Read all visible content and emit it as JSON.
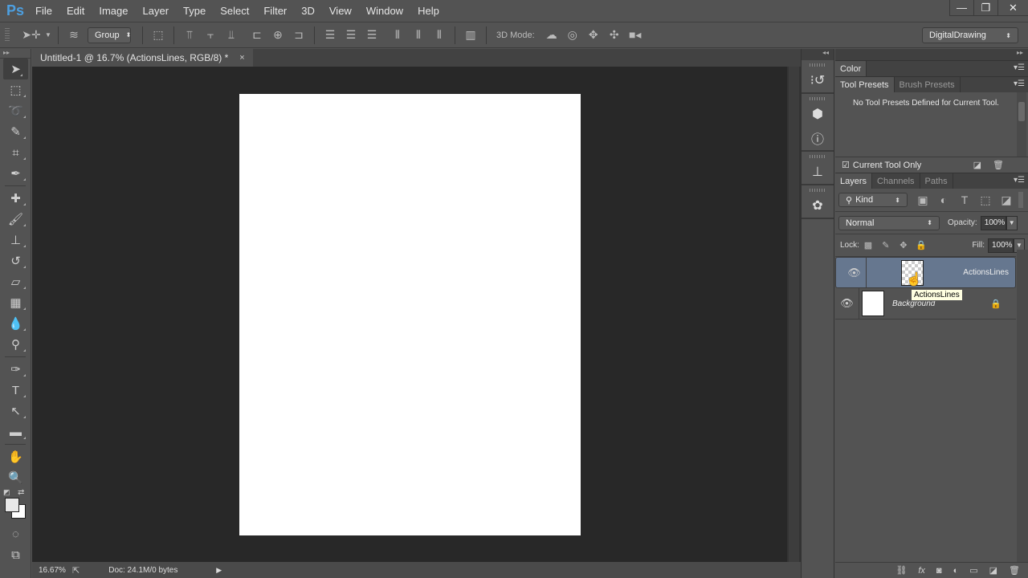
{
  "app": {
    "logo": "Ps",
    "name": "Photoshop"
  },
  "menu": [
    "File",
    "Edit",
    "Image",
    "Layer",
    "Type",
    "Select",
    "Filter",
    "3D",
    "View",
    "Window",
    "Help"
  ],
  "window_controls": {
    "minimize": "—",
    "restore": "❐",
    "close": "✕"
  },
  "options_bar": {
    "auto_select_value": "Group",
    "mode_3d_label": "3D Mode:",
    "workspace": "DigitalDrawing"
  },
  "document": {
    "tab_title": "Untitled-1 @ 16.7% (ActionsLines, RGB/8) *",
    "close_glyph": "×",
    "canvas_color": "#ffffff"
  },
  "status_bar": {
    "zoom": "16.67%",
    "doc_info": "Doc: 24.1M/0 bytes"
  },
  "tools": [
    {
      "name": "move-tool",
      "glyph": "➤"
    },
    {
      "name": "marquee-tool",
      "glyph": "⬚"
    },
    {
      "name": "lasso-tool",
      "glyph": "➰"
    },
    {
      "name": "quick-selection-tool",
      "glyph": "✎"
    },
    {
      "name": "crop-tool",
      "glyph": "⌗"
    },
    {
      "name": "eyedropper-tool",
      "glyph": "✒"
    },
    {
      "name": "healing-brush-tool",
      "glyph": "✚"
    },
    {
      "name": "brush-tool",
      "glyph": "🖌"
    },
    {
      "name": "clone-stamp-tool",
      "glyph": "⊥"
    },
    {
      "name": "history-brush-tool",
      "glyph": "↺"
    },
    {
      "name": "eraser-tool",
      "glyph": "▱"
    },
    {
      "name": "gradient-tool",
      "glyph": "▦"
    },
    {
      "name": "blur-tool",
      "glyph": "💧"
    },
    {
      "name": "dodge-tool",
      "glyph": "⚲"
    },
    {
      "name": "pen-tool",
      "glyph": "✑"
    },
    {
      "name": "type-tool",
      "glyph": "T"
    },
    {
      "name": "path-selection-tool",
      "glyph": "↖"
    },
    {
      "name": "rectangle-tool",
      "glyph": "▬"
    },
    {
      "name": "hand-tool",
      "glyph": "✋"
    },
    {
      "name": "zoom-tool",
      "glyph": "🔍"
    }
  ],
  "colors": {
    "foreground": "#e8e8e8",
    "background": "#ffffff",
    "selected_layer": "#66778f"
  },
  "panels": {
    "color_tab": "Color",
    "tool_presets_tab": "Tool Presets",
    "brush_presets_tab": "Brush Presets",
    "tool_presets_message": "No Tool Presets Defined for Current Tool.",
    "current_tool_only": "Current Tool Only",
    "current_tool_only_checked": true
  },
  "layers_panel": {
    "tabs": [
      "Layers",
      "Channels",
      "Paths"
    ],
    "filter_kind": "Kind",
    "blend_mode": "Normal",
    "opacity_label": "Opacity:",
    "opacity": "100%",
    "lock_label": "Lock:",
    "fill_label": "Fill:",
    "fill": "100%",
    "layers": [
      {
        "name": "ActionsLines",
        "visible": true,
        "selected": true,
        "thumbnail": "transparent",
        "locked": false
      },
      {
        "name": "Background",
        "visible": true,
        "selected": false,
        "thumbnail": "white",
        "locked": true
      }
    ],
    "tooltip": "ActionsLines"
  }
}
